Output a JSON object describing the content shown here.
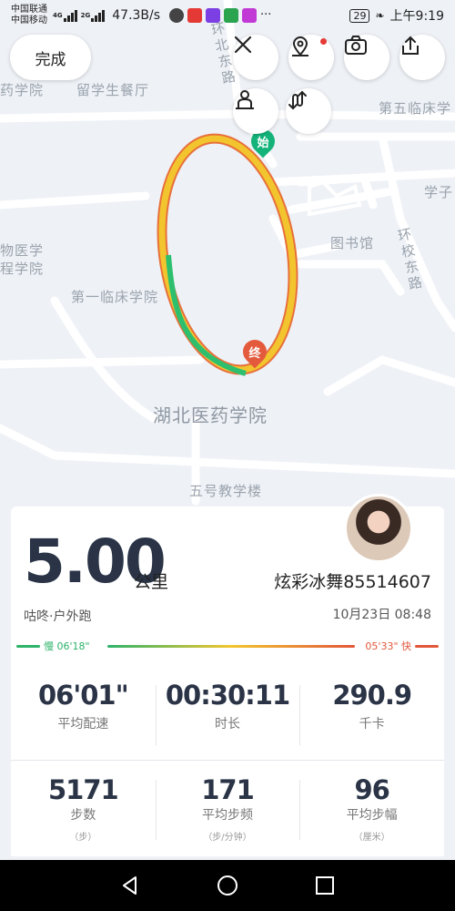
{
  "status_bar": {
    "carrier1": "中国联通",
    "carrier2": "中国移动",
    "net1": "4G",
    "net2": "2G",
    "speed": "47.3B/s",
    "battery": "29",
    "time": "上午9:19",
    "more": "···"
  },
  "map": {
    "done_label": "完成",
    "start_marker": "始",
    "end_marker": "终",
    "pois": {
      "road_huanbei": "环北东路",
      "road_huanxiao": "环校东路",
      "school_yao": "药学院",
      "canteen": "留学生餐厅",
      "fifth_clinic": "第五临床学",
      "xuezi": "学子",
      "library": "图书馆",
      "biomed1": "物医学",
      "biomed2": "程学院",
      "first_clinic": "第一临床学院",
      "university": "湖北医药学院",
      "building5": "五号教学楼"
    },
    "route_colors": {
      "slow": "#2dbf6e",
      "mid": "#f2c52e",
      "fast": "#e8703a"
    }
  },
  "summary": {
    "distance": "5.00",
    "distance_unit": "公里",
    "username": "炫彩冰舞85514607",
    "source": "咕咚·户外跑",
    "datetime": "10月23日 08:48",
    "pace_slow_label": "慢 06'18\"",
    "pace_fast_label": "05'33\" 快"
  },
  "stats_row1": [
    {
      "value": "06'01\"",
      "label": "平均配速"
    },
    {
      "value": "00:30:11",
      "label": "时长"
    },
    {
      "value": "290.9",
      "label": "千卡"
    }
  ],
  "stats_row2": [
    {
      "value": "5171",
      "label": "步数",
      "unit": "（步）"
    },
    {
      "value": "171",
      "label": "平均步频",
      "unit": "（步/分钟）"
    },
    {
      "value": "96",
      "label": "平均步幅",
      "unit": "（厘米）"
    }
  ]
}
